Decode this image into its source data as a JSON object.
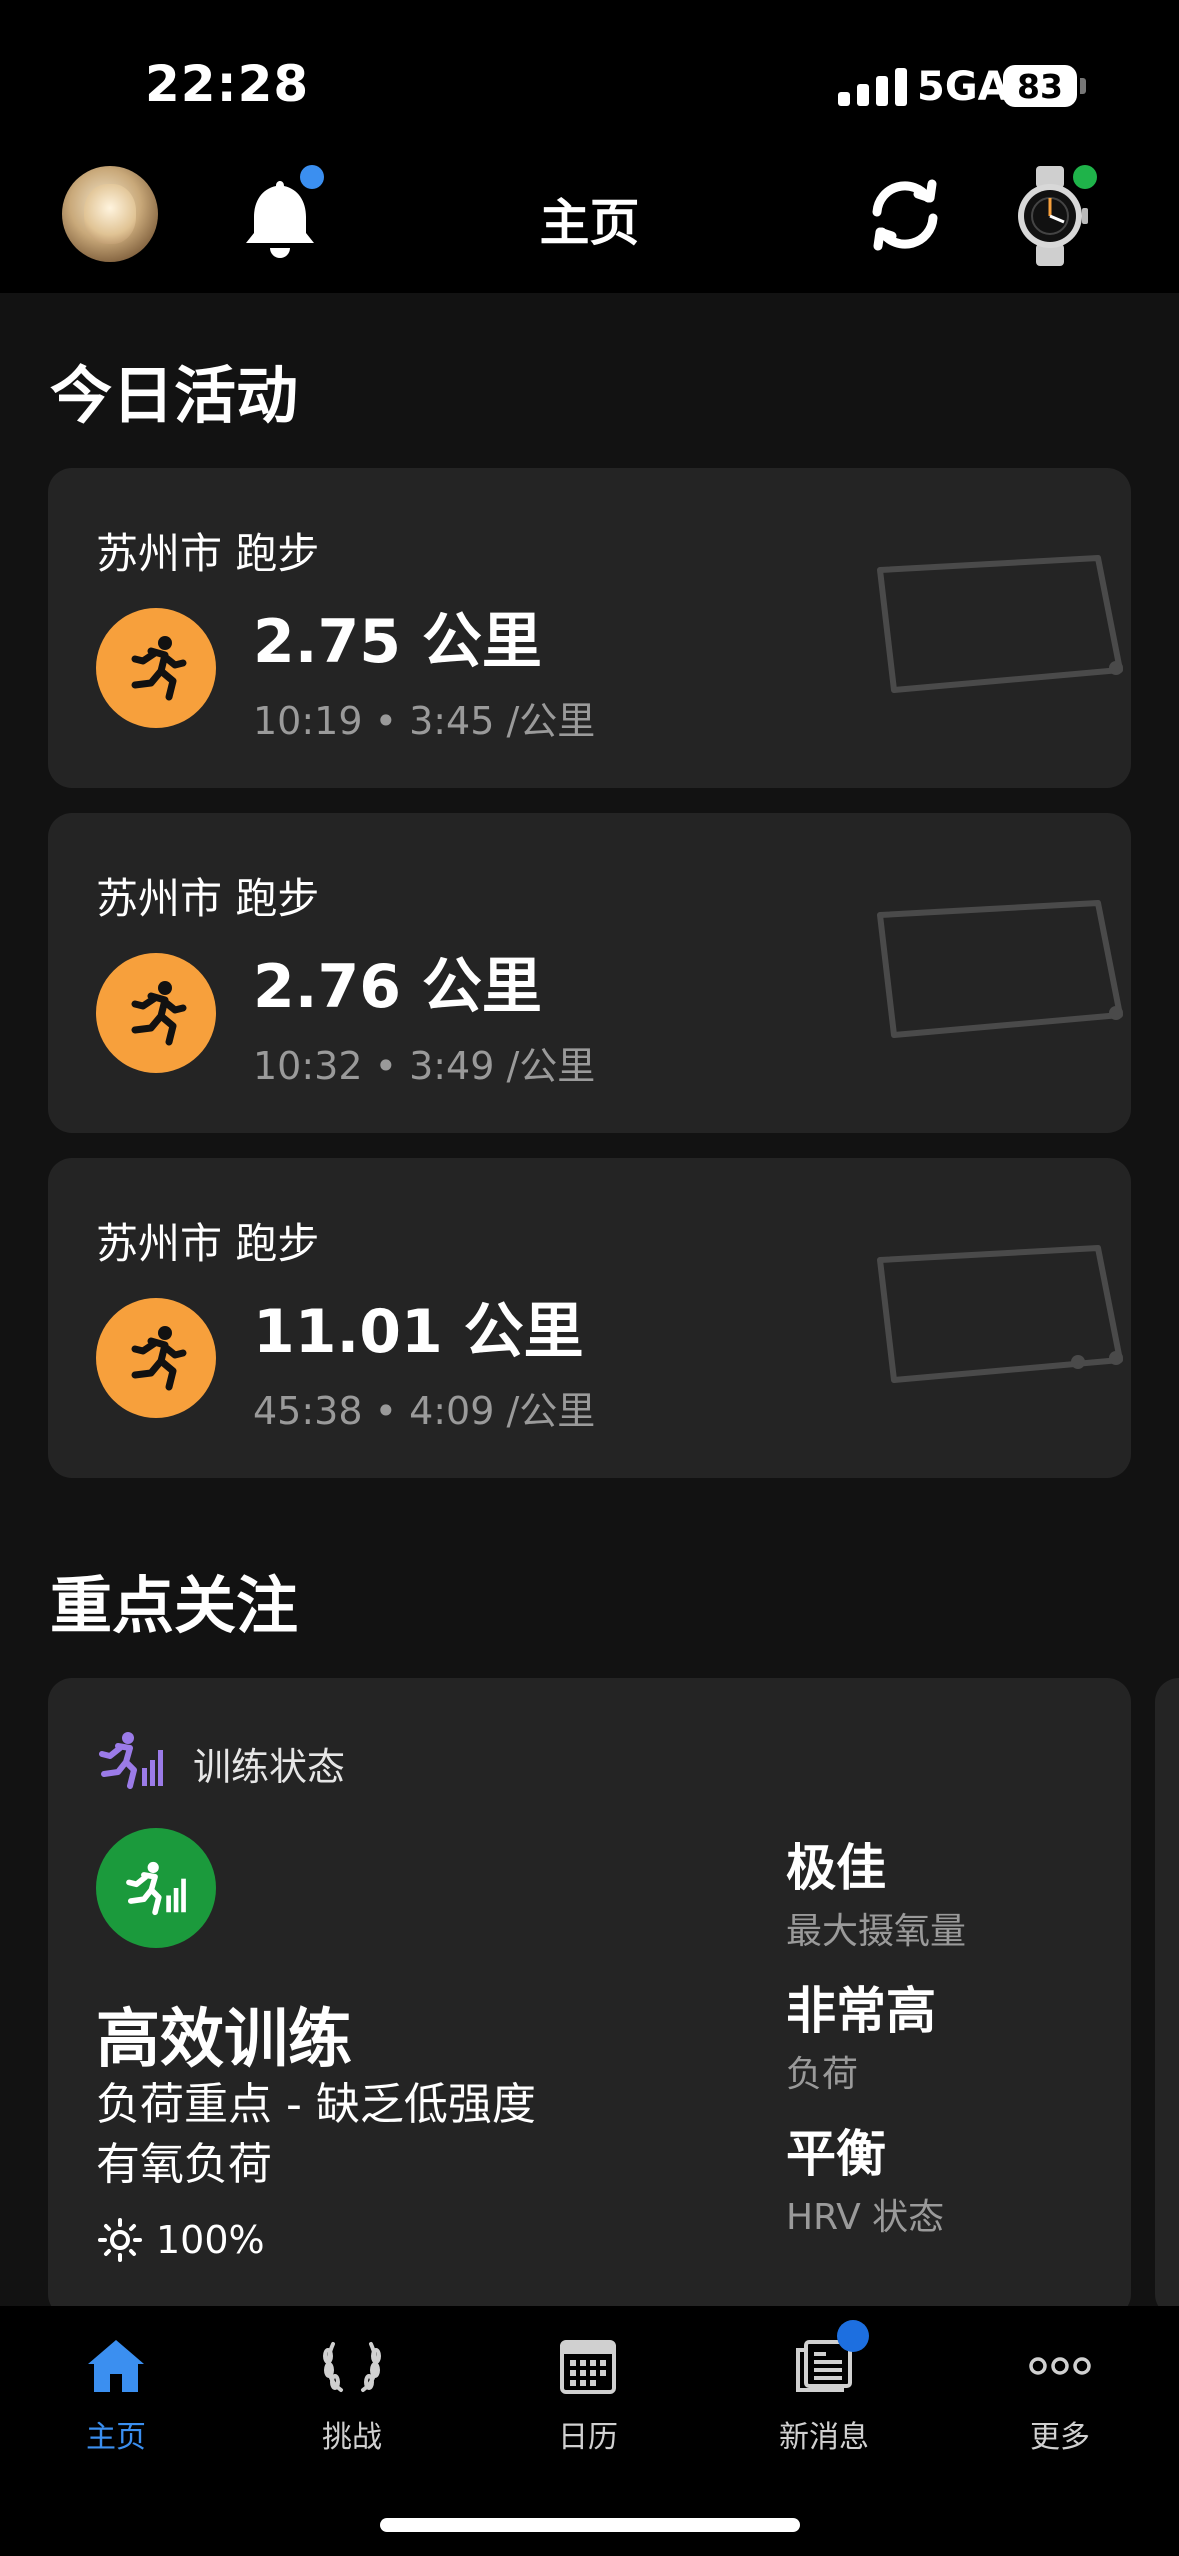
{
  "status_bar": {
    "time": "22:28",
    "network": "5GA",
    "battery": "83"
  },
  "header": {
    "title": "主页"
  },
  "today": {
    "title": "今日活动",
    "activities": [
      {
        "location": "苏州市 跑步",
        "distance": "2.75 公里",
        "meta": "10:19 • 3:45 /公里"
      },
      {
        "location": "苏州市 跑步",
        "distance": "2.76 公里",
        "meta": "10:32 • 3:49 /公里"
      },
      {
        "location": "苏州市 跑步",
        "distance": "11.01 公里",
        "meta": "45:38 • 4:09 /公里"
      }
    ]
  },
  "focus": {
    "title": "重点关注",
    "card": {
      "header": "训练状态",
      "status": "高效训练",
      "desc_line1": "负荷重点 - 缺乏低强度",
      "desc_line2": "有氧负荷",
      "percent": "100%",
      "metrics": [
        {
          "value": "极佳",
          "label": "最大摄氧量"
        },
        {
          "value": "非常高",
          "label": "负荷"
        },
        {
          "value": "平衡",
          "label": "HRV 状态"
        }
      ]
    }
  },
  "tabs": [
    {
      "label": "主页",
      "icon": "home-icon",
      "active": true
    },
    {
      "label": "挑战",
      "icon": "laurel-icon"
    },
    {
      "label": "日历",
      "icon": "calendar-icon"
    },
    {
      "label": "新消息",
      "icon": "news-icon"
    },
    {
      "label": "更多",
      "icon": "more-icon"
    }
  ],
  "colors": {
    "accent": "#3b8ff0",
    "run_orange": "#f7a03c",
    "training_green": "#1b9a3c",
    "card_bg": "#242424",
    "page_bg": "#121212"
  }
}
